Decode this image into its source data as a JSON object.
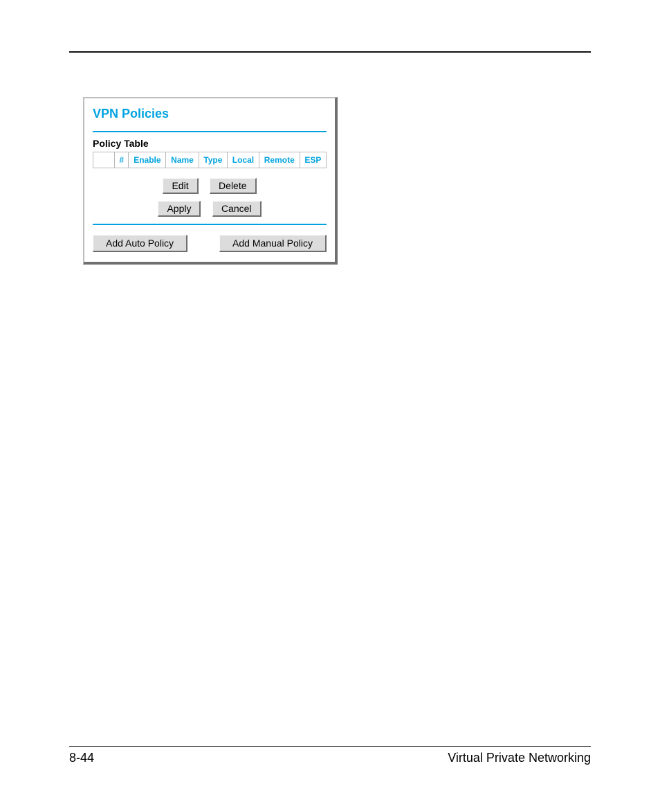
{
  "panel": {
    "title": "VPN Policies",
    "subhead": "Policy Table",
    "columns": {
      "sel": "",
      "num": "#",
      "enable": "Enable",
      "name": "Name",
      "type": "Type",
      "local": "Local",
      "remote": "Remote",
      "esp": "ESP"
    },
    "buttons": {
      "edit": "Edit",
      "delete": "Delete",
      "apply": "Apply",
      "cancel": "Cancel",
      "add_auto": "Add Auto Policy",
      "add_manual": "Add Manual Policy"
    }
  },
  "footer": {
    "page": "8-44",
    "section": "Virtual Private Networking"
  }
}
